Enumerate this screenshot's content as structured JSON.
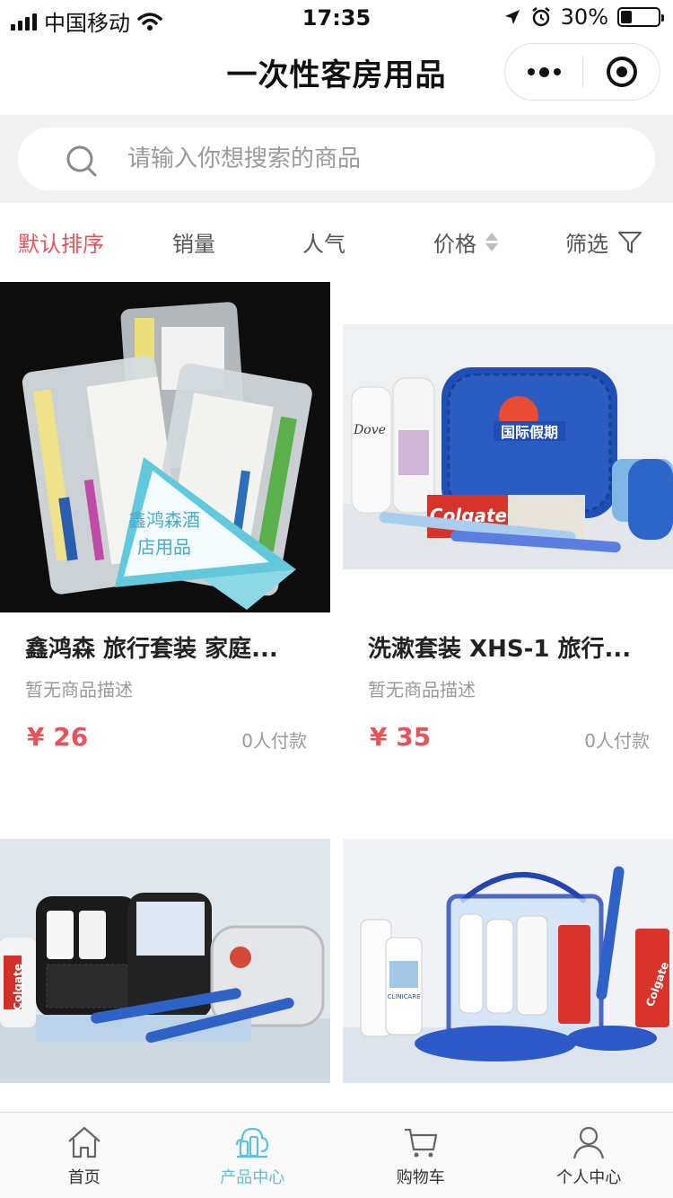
{
  "status_bar": {
    "carrier": "中国移动",
    "time": "17:35",
    "battery": "30%",
    "battery_level": 0.3
  },
  "nav": {
    "title": "一次性客房用品"
  },
  "search": {
    "placeholder": "请输入你想搜索的商品"
  },
  "sort": {
    "items": [
      {
        "label": "默认排序"
      },
      {
        "label": "销量"
      },
      {
        "label": "人气"
      },
      {
        "label": "价格"
      },
      {
        "label": "筛选"
      }
    ],
    "active_color": "#e8535a"
  },
  "products": [
    {
      "title": "鑫鸿森 旅行套装 家庭...",
      "desc": "暂无商品描述",
      "price": "¥ 26",
      "sold": "0人付款",
      "badge_text_1": "鑫鸿森酒",
      "badge_text_2": "店用品"
    },
    {
      "title": "洗漱套装 XHS-1 旅行...",
      "desc": "暂无商品描述",
      "price": "¥ 35",
      "sold": "0人付款",
      "case_text": "国际假期",
      "paste_brand": "Colgate",
      "bottle_brand": "Dove"
    },
    {
      "paste_brand": "Colgate"
    },
    {
      "paste_brand": "Colgate",
      "bottle_brand": "CLINICARE"
    }
  ],
  "tabs": [
    {
      "label": "首页",
      "icon": "home-icon"
    },
    {
      "label": "产品中心",
      "icon": "product-center-icon"
    },
    {
      "label": "购物车",
      "icon": "cart-icon"
    },
    {
      "label": "个人中心",
      "icon": "user-icon"
    }
  ],
  "colors": {
    "accent": "#e8535a",
    "tab_active": "#5bbfe0",
    "page_bg": "#f2f2f2"
  }
}
